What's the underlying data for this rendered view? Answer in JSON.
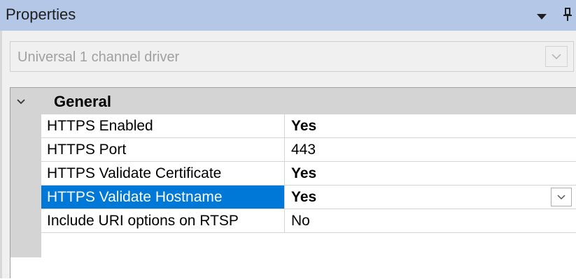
{
  "panel": {
    "title": "Properties"
  },
  "object_selector": {
    "selected_value": "Universal 1 channel driver"
  },
  "grid": {
    "category": {
      "label": "General",
      "expanded": true
    },
    "rows": [
      {
        "name": "HTTPS Enabled",
        "value": "Yes",
        "value_bold": true,
        "selected": false
      },
      {
        "name": "HTTPS Port",
        "value": "443",
        "value_bold": false,
        "selected": false
      },
      {
        "name": "HTTPS Validate Certificate",
        "value": "Yes",
        "value_bold": true,
        "selected": false
      },
      {
        "name": "HTTPS Validate Hostname",
        "value": "Yes",
        "value_bold": true,
        "selected": true
      },
      {
        "name": "Include URI options on RTSP",
        "value": "No",
        "value_bold": false,
        "selected": false
      }
    ]
  },
  "icons": {
    "title_menu": "dropdown-arrow-icon",
    "title_pin": "pin-icon",
    "selector_dropdown": "chevron-down-icon",
    "category_toggle": "chevron-down-icon",
    "value_dropdown": "chevron-down-icon"
  },
  "colors": {
    "title_bar": "#b4c7e7",
    "selection": "#0078d7",
    "gutter": "#d4d4d4",
    "panel_bg": "#f0f0f0"
  }
}
